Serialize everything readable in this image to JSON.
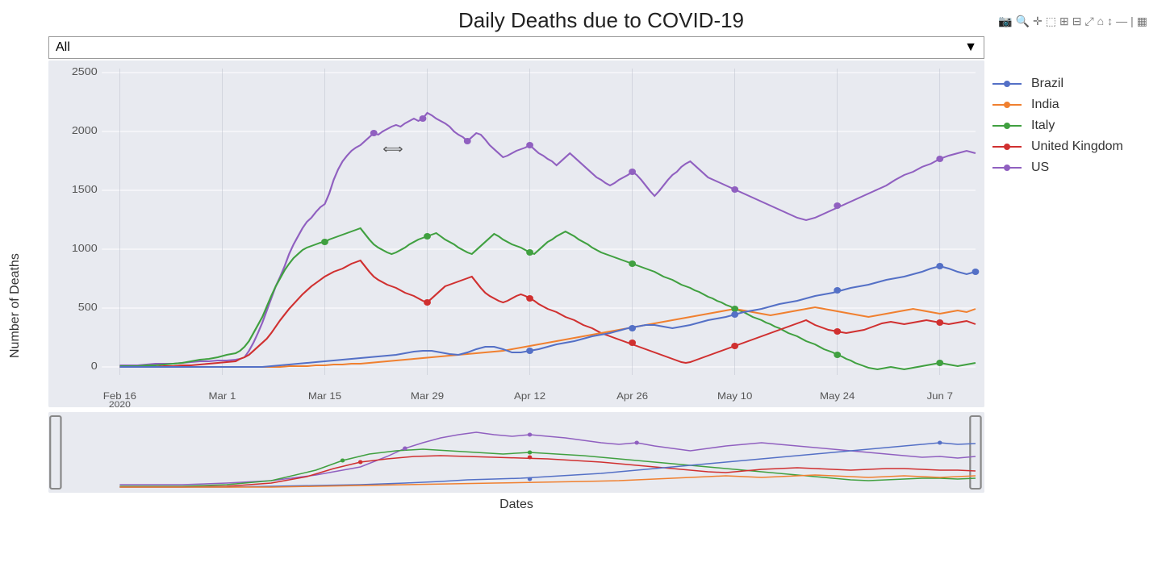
{
  "title": "Daily Deaths due to COVID-19",
  "yAxisLabel": "Number of Deaths",
  "xAxisLabel": "Dates",
  "dropdown": {
    "value": "All",
    "placeholder": "All"
  },
  "legend": [
    {
      "id": "brazil",
      "label": "Brazil",
      "color": "#5470c6"
    },
    {
      "id": "india",
      "label": "India",
      "color": "#f08030"
    },
    {
      "id": "italy",
      "label": "Italy",
      "color": "#40a040"
    },
    {
      "id": "uk",
      "label": "United Kingdom",
      "color": "#d03030"
    },
    {
      "id": "us",
      "label": "US",
      "color": "#9060c0"
    }
  ],
  "xTicks": [
    "Feb 16\n2020",
    "Mar 1",
    "Mar 15",
    "Mar 29",
    "Apr 12",
    "Apr 26",
    "May 10",
    "May 24",
    "Jun 7"
  ],
  "yTicks": [
    "0",
    "500",
    "1000",
    "1500",
    "2000",
    "2500"
  ],
  "toolbar": {
    "icons": [
      "📷",
      "🔍",
      "+",
      "⊞",
      "◻",
      "⊟",
      "⊟",
      "🏠",
      "↔",
      "—",
      "—",
      "≡"
    ]
  },
  "cursor": {
    "symbol": "⟺"
  }
}
